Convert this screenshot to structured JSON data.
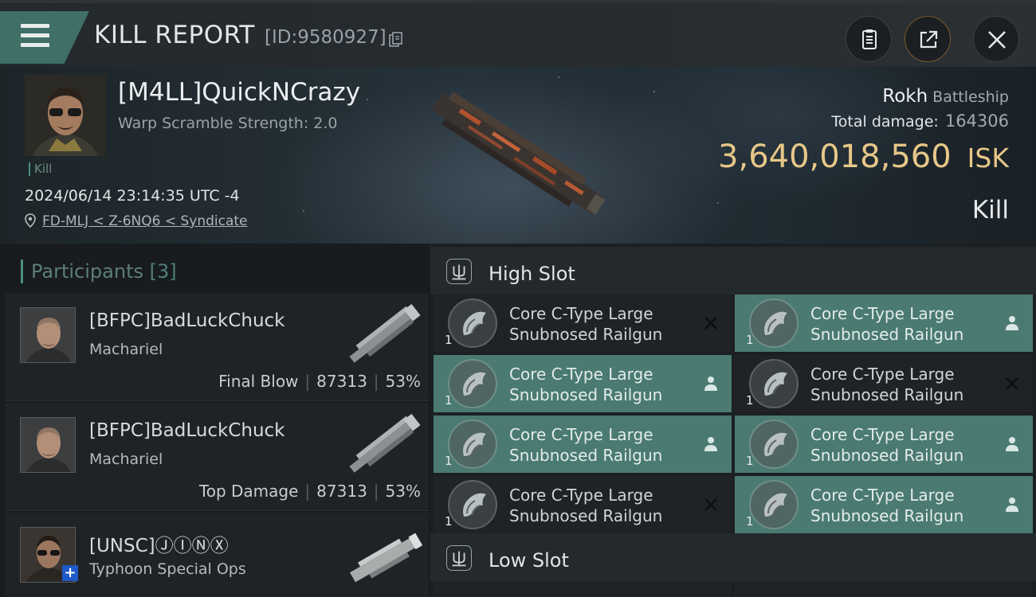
{
  "header": {
    "title": "KILL REPORT",
    "report_id": "[ID:9580927]"
  },
  "victim": {
    "name": "[M4LL]QuickNCrazy",
    "warp_scramble": "Warp Scramble Strength: 2.0",
    "kill_tag": "Kill",
    "datetime": "2024/06/14 23:14:35 UTC -4",
    "location": "FD-MLJ < Z-6NQ6 < Syndicate",
    "ship": "Rokh",
    "ship_class": "Battleship",
    "total_damage_label": "Total damage:",
    "total_damage": "164306",
    "isk_value": "3,640,018,560",
    "isk_unit": "ISK",
    "result": "Kill"
  },
  "participants": {
    "title": "Participants",
    "count": "[3]",
    "items": [
      {
        "name": "[BFPC]BadLuckChuck",
        "ship": "Machariel",
        "role": "Final Blow",
        "damage": "87313",
        "percent": "53%"
      },
      {
        "name": "[BFPC]BadLuckChuck",
        "ship": "Machariel",
        "role": "Top Damage",
        "damage": "87313",
        "percent": "53%"
      },
      {
        "name": "[UNSC]ⒿⒾⓃⓍ",
        "ship": "Typhoon Special Ops"
      }
    ]
  },
  "fitting": {
    "high_slot_label": "High Slot",
    "low_slot_label": "Low Slot",
    "modules": [
      {
        "line1": "Core C-Type Large",
        "line2": "Snubnosed Railgun",
        "qty": "1",
        "status": "destroyed"
      },
      {
        "line1": "Core C-Type Large",
        "line2": "Snubnosed Railgun",
        "qty": "1",
        "status": "dropped"
      },
      {
        "line1": "Core C-Type Large",
        "line2": "Snubnosed Railgun",
        "qty": "1",
        "status": "dropped"
      },
      {
        "line1": "Core C-Type Large",
        "line2": "Snubnosed Railgun",
        "qty": "1",
        "status": "destroyed"
      },
      {
        "line1": "Core C-Type Large",
        "line2": "Snubnosed Railgun",
        "qty": "1",
        "status": "dropped"
      },
      {
        "line1": "Core C-Type Large",
        "line2": "Snubnosed Railgun",
        "qty": "1",
        "status": "dropped"
      },
      {
        "line1": "Core C-Type Large",
        "line2": "Snubnosed Railgun",
        "qty": "1",
        "status": "destroyed"
      },
      {
        "line1": "Core C-Type Large",
        "line2": "Snubnosed Railgun",
        "qty": "1",
        "status": "dropped"
      }
    ]
  },
  "colors": {
    "accent_teal": "#4a7a72",
    "isk_gold": "#e7c788",
    "menu_teal": "#3f6f66"
  },
  "icons": [
    "menu-icon",
    "copy-icon",
    "clipboard-icon",
    "share-icon",
    "close-icon",
    "location-pin-icon",
    "slot-icon",
    "destroyed-x-icon",
    "dropped-person-icon"
  ]
}
